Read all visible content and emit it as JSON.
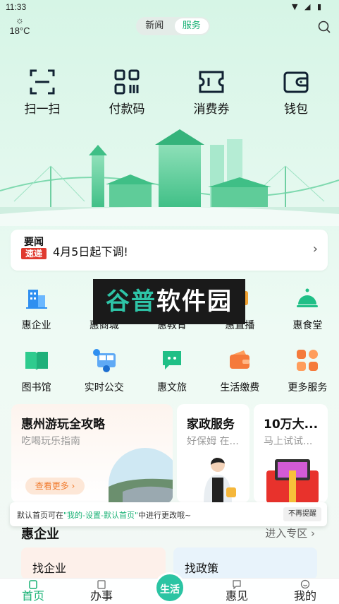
{
  "status_bar": {
    "time": "11:33",
    "indicators": "▼ ◢ ▮"
  },
  "weather": {
    "icon": "sun-icon",
    "temperature": "18°C"
  },
  "top_tabs": [
    {
      "label": "新闻",
      "active": false
    },
    {
      "label": "服务",
      "active": true
    }
  ],
  "quick_actions": [
    {
      "label": "扫一扫",
      "icon": "scan-icon"
    },
    {
      "label": "付款码",
      "icon": "payment-code-icon"
    },
    {
      "label": "消费券",
      "icon": "coupon-icon"
    },
    {
      "label": "钱包",
      "icon": "wallet-icon"
    }
  ],
  "news": {
    "badge_top": "要闻",
    "badge_bottom": "速递",
    "headline": "4月5日起下调!",
    "arrow": "›"
  },
  "watermark": {
    "text_a": "谷普",
    "text_b": "软件园"
  },
  "services": [
    {
      "label": "惠企业",
      "icon": "building-icon"
    },
    {
      "label": "惠商城",
      "icon": "shop-icon"
    },
    {
      "label": "惠教育",
      "icon": "education-icon"
    },
    {
      "label": "惠直播",
      "icon": "live-icon"
    },
    {
      "label": "惠食堂",
      "icon": "canteen-bell-icon"
    },
    {
      "label": "图书馆",
      "icon": "book-icon"
    },
    {
      "label": "实时公交",
      "icon": "bus-icon"
    },
    {
      "label": "惠文旅",
      "icon": "chat-icon"
    },
    {
      "label": "生活缴费",
      "icon": "wallet-pay-icon"
    },
    {
      "label": "更多服务",
      "icon": "grid-more-icon"
    }
  ],
  "promos": [
    {
      "title": "惠州游玩全攻略",
      "subtitle": "吃喝玩乐指南",
      "button": "查看更多 ›"
    },
    {
      "title": "家政服务",
      "subtitle": "好保姆 在..."
    },
    {
      "title": "10万大...",
      "subtitle": "马上试试..."
    }
  ],
  "toast": {
    "msg_a": "默认首页可在",
    "msg_highlight": "\"我的-设置-默认首页\"",
    "msg_b": "中进行更改哦~",
    "dismiss": "不再提醒"
  },
  "section": {
    "title": "惠企业",
    "link": "进入专区 ›"
  },
  "mini_cards": [
    {
      "title": "找企业"
    },
    {
      "title": "找政策"
    }
  ],
  "bottom_nav": [
    {
      "label": "首页",
      "active": true
    },
    {
      "label": "办事",
      "active": false
    },
    {
      "label": "惠见",
      "active": false
    },
    {
      "label": "我的",
      "active": false
    }
  ],
  "center_button": "生活",
  "colors": {
    "accent": "#19b275",
    "badge_red": "#e03a2f",
    "teal": "#2bc4a3"
  }
}
